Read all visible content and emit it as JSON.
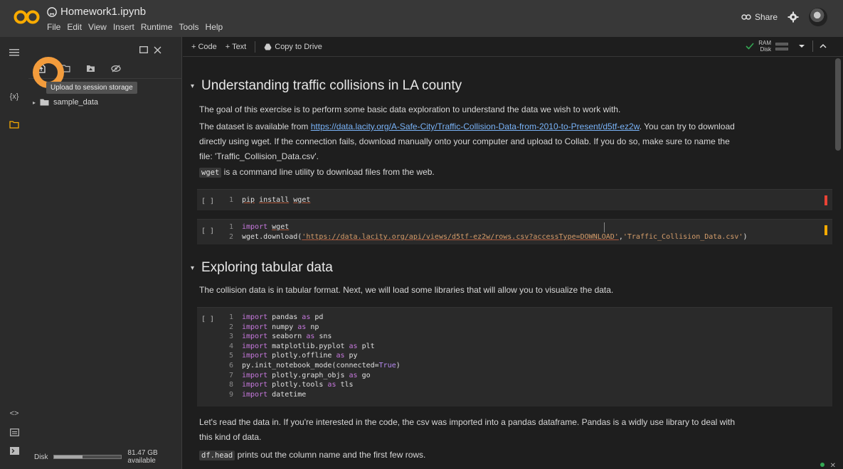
{
  "header": {
    "title": "Homework1.ipynb",
    "menu": [
      "File",
      "Edit",
      "View",
      "Insert",
      "Runtime",
      "Tools",
      "Help"
    ],
    "share_label": "Share"
  },
  "colors": {
    "accent": "#f9ab00",
    "highlight_ring": "#f39c3c",
    "link": "#7ab4f9",
    "ok": "#34a853",
    "error": "#ea4335"
  },
  "sidebar": {
    "tooltip": "Upload to session storage",
    "folder": "sample_data",
    "disk_label": "Disk",
    "disk_used_fraction": 0.42,
    "disk_available": "81.47 GB available",
    "rail_icons": [
      "menu-icon",
      "variables-icon",
      "folder-icon",
      "code-snippets-icon",
      "command-palette-icon",
      "terminal-icon"
    ]
  },
  "toolbar": {
    "add_code": "+ Code",
    "add_text": "+ Text",
    "copy_to_drive": "Copy to Drive",
    "ram_label": "RAM",
    "disk_label": "Disk"
  },
  "notebook": {
    "section1_title": "Understanding traffic collisions in LA county",
    "para1": "The goal of this exercise is to perform some basic data exploration to understand the data we wish to work with.",
    "para2_prefix": "The dataset is available from ",
    "para2_link": "https://data.lacity.org/A-Safe-City/Traffic-Collision-Data-from-2010-to-Present/d5tf-ez2w",
    "para2_suffix": ". You can try to download",
    "para2_line2": "directly using wget. If the connection fails, download manually onto your computer and upload to Collab. If you do so, make sure to name the",
    "para2_line3": "file: 'Traffic_Collision_Data.csv'.",
    "para3_code": "wget",
    "para3_rest": " is a command line utility to download files from the web.",
    "cell_marker": "[ ]",
    "cell1": {
      "ln": "1",
      "pip": "pip",
      "install": "install",
      "wget": "wget"
    },
    "cell2": {
      "l1_ln": "1",
      "l1_kw": "import",
      "l1_mod": "wget",
      "l2_ln": "2",
      "l2_fn": "wget.download(",
      "l2_url": "'https://data.lacity.org/api/views/d5tf-ez2w/rows.csv?accessType=DOWNLOAD'",
      "l2_comma": ",",
      "l2_file": "'Traffic_Collision_Data.csv'",
      "l2_close": ")"
    },
    "section2_title": "Exploring tabular data",
    "para4": "The collision data is in tabular format. Next, we will load some libraries that will allow you to visualize the data.",
    "cell3": [
      {
        "ln": "1",
        "kw": "import",
        "mod": " pandas ",
        "as": "as",
        "alias": " pd"
      },
      {
        "ln": "2",
        "kw": "import",
        "mod": " numpy ",
        "as": "as",
        "alias": " np"
      },
      {
        "ln": "3",
        "kw": "import",
        "mod": " seaborn ",
        "as": "as",
        "alias": " sns"
      },
      {
        "ln": "4",
        "kw": "import",
        "mod": " matplotlib.pyplot ",
        "as": "as",
        "alias": " plt"
      },
      {
        "ln": "5",
        "kw": "import",
        "mod": " plotly.offline ",
        "as": "as",
        "alias": " py"
      },
      {
        "ln": "6",
        "kw": "",
        "mod": "py.init_notebook_mode(connected=",
        "as": "True",
        "alias": ")"
      },
      {
        "ln": "7",
        "kw": "import",
        "mod": " plotly.graph_objs ",
        "as": "as",
        "alias": " go"
      },
      {
        "ln": "8",
        "kw": "import",
        "mod": " plotly.tools ",
        "as": "as",
        "alias": " tls"
      },
      {
        "ln": "9",
        "kw": "import",
        "mod": " datetime",
        "as": "",
        "alias": ""
      }
    ],
    "para5_line1": "Let's read the data in. If you're interested in the code, the csv was imported into a pandas dataframe. Pandas is a widly use library to deal with",
    "para5_line2": "this kind of data.",
    "para6_code": "df.head",
    "para6_rest": " prints out the column name and the first few rows."
  }
}
